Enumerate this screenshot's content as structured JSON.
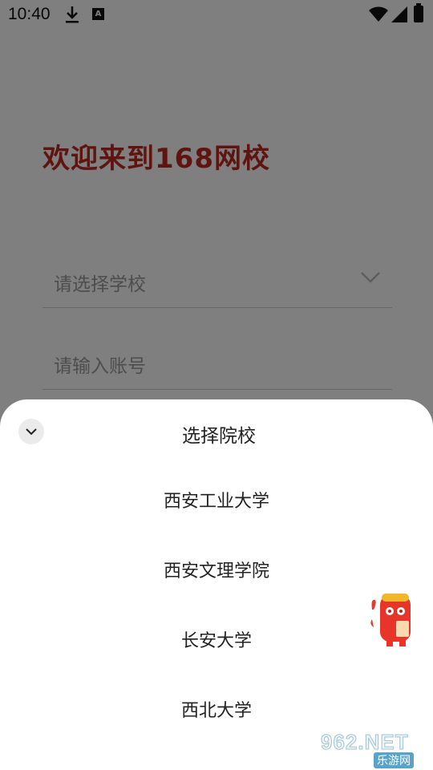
{
  "status_bar": {
    "time": "10:40"
  },
  "login": {
    "welcome": "欢迎来到168网校",
    "school_placeholder": "请选择学校",
    "account_placeholder": "请输入账号"
  },
  "sheet": {
    "title": "选择院校",
    "items": [
      "西安工业大学",
      "西安文理学院",
      "长安大学",
      "西北大学"
    ]
  },
  "watermark": {
    "main": "962.NET",
    "sub": "乐游网"
  },
  "colors": {
    "accent": "#c0281e",
    "overlay": "rgba(0,0,0,0.5)"
  }
}
